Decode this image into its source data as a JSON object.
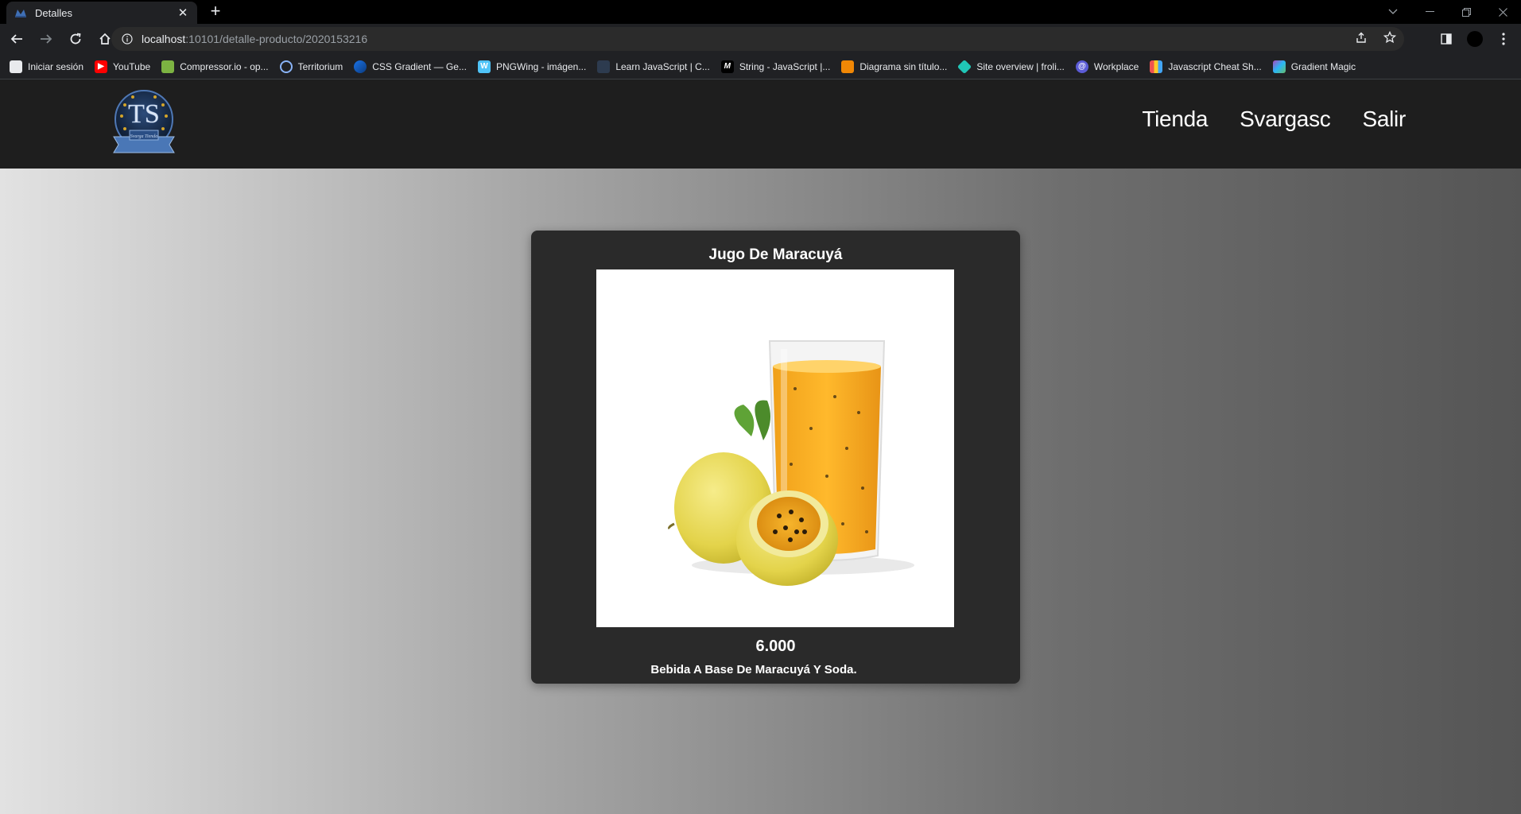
{
  "browser": {
    "tab_title": "Detalles",
    "url_host": "localhost",
    "url_path": ":10101/detalle-producto/2020153216",
    "bookmarks": [
      {
        "label": "Iniciar sesión",
        "icon": "page-icon",
        "color": "#e8eaed"
      },
      {
        "label": "YouTube",
        "icon": "youtube-icon",
        "color": "#ff0000"
      },
      {
        "label": "Compressor.io - op...",
        "icon": "compressor-icon",
        "color": "#7cb342"
      },
      {
        "label": "Territorium",
        "icon": "territorium-icon",
        "color": "#8ab4f8"
      },
      {
        "label": "CSS Gradient — Ge...",
        "icon": "css-gradient-icon",
        "color": "#1a73e8"
      },
      {
        "label": "PNGWing - imágen...",
        "icon": "pngwing-icon",
        "color": "#4fc3f7"
      },
      {
        "label": "Learn JavaScript | C...",
        "icon": "learn-js-icon",
        "color": "#2d3b4f"
      },
      {
        "label": "String - JavaScript |...",
        "icon": "mdn-icon",
        "color": "#000000"
      },
      {
        "label": "Diagrama sin título...",
        "icon": "drawio-icon",
        "color": "#f08705"
      },
      {
        "label": "Site overview | froli...",
        "icon": "netlify-icon",
        "color": "#20c6b7"
      },
      {
        "label": "Workplace",
        "icon": "workplace-icon",
        "color": "#5b5bd6"
      },
      {
        "label": "Javascript Cheat Sh...",
        "icon": "cheatsheet-icon",
        "color": "#ef5350"
      },
      {
        "label": "Gradient Magic",
        "icon": "gradient-magic-icon",
        "color": "#ab47bc"
      }
    ]
  },
  "site": {
    "nav": [
      "Tienda",
      "Svargasc",
      "Salir"
    ]
  },
  "product": {
    "title": "Jugo De Maracuyá",
    "price": "6.000",
    "description": "Bebida A Base De Maracuyá Y Soda."
  },
  "colors": {
    "header_bg": "#1e1e1e",
    "card_bg": "#2a2a2a",
    "juice": "#f4a81d"
  }
}
